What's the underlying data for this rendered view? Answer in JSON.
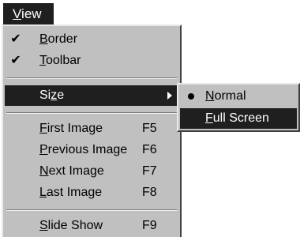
{
  "menubar": {
    "title_mnemonic": "V",
    "title_rest": "iew"
  },
  "menu": {
    "border": {
      "checked": true,
      "mnemonic": "B",
      "rest": "order"
    },
    "toolbar": {
      "checked": true,
      "mnemonic": "T",
      "rest": "oolbar"
    },
    "size": {
      "pre": "Si",
      "mnemonic": "z",
      "rest": "e",
      "highlighted": true
    },
    "first_image": {
      "mnemonic": "F",
      "rest": "irst Image",
      "shortcut": "F5"
    },
    "previous_image": {
      "mnemonic": "P",
      "rest": "revious Image",
      "shortcut": "F6"
    },
    "next_image": {
      "mnemonic": "N",
      "rest": "ext Image",
      "shortcut": "F7"
    },
    "last_image": {
      "mnemonic": "L",
      "rest": "ast Image",
      "shortcut": "F8"
    },
    "slide_show": {
      "mnemonic": "S",
      "rest": "lide Show",
      "shortcut": "F9"
    }
  },
  "submenu": {
    "normal": {
      "mnemonic": "N",
      "rest": "ormal",
      "radio_selected": true
    },
    "full_screen": {
      "mnemonic": "F",
      "rest": "ull Screen",
      "highlighted": true
    }
  },
  "colors": {
    "menu_background": "#c0c0c0",
    "highlight_background": "#1f1f1f",
    "highlight_text": "#ffffff"
  },
  "icons": {
    "check": "check-icon",
    "submenu_arrow": "submenu-arrow-icon",
    "radio_bullet": "radio-bullet-icon"
  }
}
